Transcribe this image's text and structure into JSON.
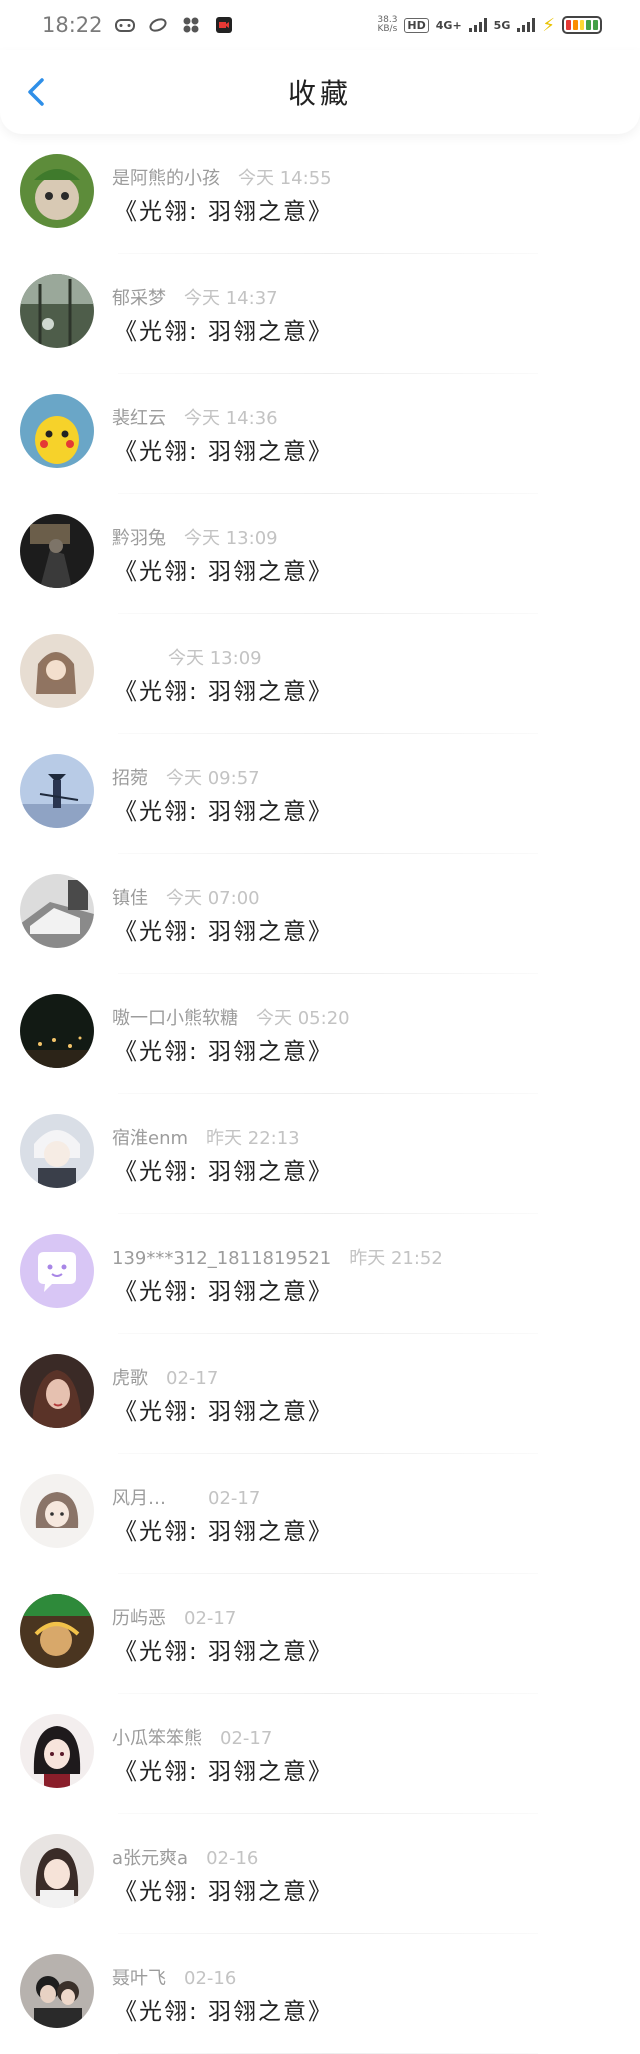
{
  "status_bar": {
    "time": "18:22",
    "speed_value": "38.3",
    "speed_unit": "KB/s",
    "hd_label": "HD",
    "net1": "4G+",
    "net2": "5G",
    "left_icons": [
      "game-icon",
      "link-icon",
      "fan-icon",
      "video-icon"
    ]
  },
  "header": {
    "title": "收藏",
    "back_icon": "chevron-left-icon",
    "accent": "#2f8fe8"
  },
  "items": [
    {
      "name": "是阿熊的小孩",
      "time": "今天 14:55",
      "title": "《光翎: 羽翎之意》"
    },
    {
      "name": "郁采梦",
      "time": "今天 14:37",
      "title": "《光翎: 羽翎之意》"
    },
    {
      "name": "裴红云",
      "time": "今天 14:36",
      "title": "《光翎: 羽翎之意》"
    },
    {
      "name": "黔羽兔",
      "time": "今天 13:09",
      "title": "《光翎: 羽翎之意》"
    },
    {
      "name": "",
      "time": "今天 13:09",
      "title": "《光翎: 羽翎之意》"
    },
    {
      "name": "招菀",
      "time": "今天 09:57",
      "title": "《光翎: 羽翎之意》"
    },
    {
      "name": "镇佳",
      "time": "今天 07:00",
      "title": "《光翎: 羽翎之意》"
    },
    {
      "name": "嗷一口小熊软糖",
      "time": "今天 05:20",
      "title": "《光翎: 羽翎之意》"
    },
    {
      "name": "宿淮enm",
      "time": "昨天 22:13",
      "title": "《光翎: 羽翎之意》"
    },
    {
      "name": "139***312_1811819521",
      "time": "昨天 21:52",
      "title": "《光翎: 羽翎之意》"
    },
    {
      "name": "虎歌",
      "time": "02-17",
      "title": "《光翎: 羽翎之意》"
    },
    {
      "name": "风月…",
      "time": "02-17",
      "title": "《光翎: 羽翎之意》"
    },
    {
      "name": "历屿恶",
      "time": "02-17",
      "title": "《光翎: 羽翎之意》"
    },
    {
      "name": "小瓜笨笨熊",
      "time": "02-17",
      "title": "《光翎: 羽翎之意》"
    },
    {
      "name": "a张元爽a",
      "time": "02-16",
      "title": "《光翎: 羽翎之意》"
    },
    {
      "name": "聂叶飞",
      "time": "02-16",
      "title": "《光翎: 羽翎之意》"
    }
  ]
}
